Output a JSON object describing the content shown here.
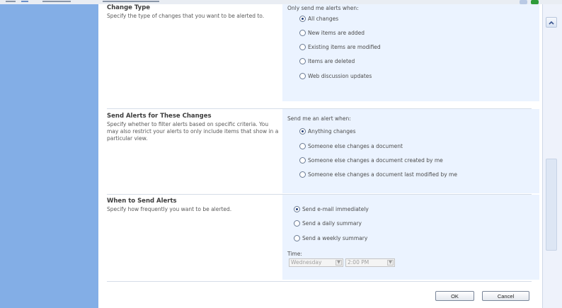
{
  "change_type": {
    "title": "Change Type",
    "description": "Specify the type of changes that you want to be alerted to.",
    "prompt": "Only send me alerts when:",
    "options": [
      "All changes",
      "New items are added",
      "Existing items are modified",
      "Items are deleted",
      "Web discussion updates"
    ],
    "selected": "All changes"
  },
  "send_alerts_for": {
    "title": "Send Alerts for These Changes",
    "description": "Specify whether to filter alerts based on specific criteria. You may also restrict your alerts to only include items that show in a particular view.",
    "prompt": "Send me an alert when:",
    "options": [
      "Anything changes",
      "Someone else changes a document",
      "Someone else changes a document created by me",
      "Someone else changes a document last modified by me"
    ],
    "selected": "Anything changes"
  },
  "when_to_send": {
    "title": "When to Send Alerts",
    "description": "Specify how frequently you want to be alerted.",
    "options": [
      "Send e-mail immediately",
      "Send a daily summary",
      "Send a weekly summary"
    ],
    "selected": "Send e-mail immediately",
    "time_label": "Time:",
    "day_value": "Wednesday",
    "time_value": "2:00 PM"
  },
  "buttons": {
    "ok": "OK",
    "cancel": "Cancel"
  },
  "icons": {
    "scroll_up": "chevron-up-icon",
    "dropdown": "chevron-down-icon"
  },
  "colors": {
    "left_nav": "#83aee6",
    "option_panel": "#ebf3ff",
    "tray_green": "#2e9b3a"
  }
}
